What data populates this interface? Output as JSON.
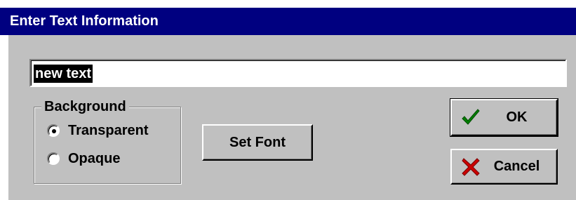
{
  "window": {
    "title": "Enter Text Information",
    "title_bar_color": "#000080"
  },
  "text_field": {
    "value": "new text",
    "selected": true
  },
  "background_group": {
    "legend": "Background",
    "options": [
      {
        "label": "Transparent",
        "checked": true
      },
      {
        "label": "Opaque",
        "checked": false
      }
    ]
  },
  "buttons": {
    "set_font": "Set Font",
    "ok": "OK",
    "ok_icon": "checkmark-icon",
    "ok_icon_color": "#008000",
    "cancel": "Cancel",
    "cancel_icon": "x-icon",
    "cancel_icon_color": "#cc0000"
  }
}
